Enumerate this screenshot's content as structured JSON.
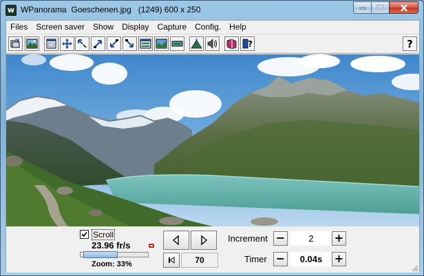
{
  "window": {
    "title": "WPanorama  Goeschenen.jpg   (1249) 600 x 250",
    "icon_letter": "w"
  },
  "caption_buttons": [
    {
      "name": "minimize",
      "icon": "minimize-icon"
    },
    {
      "name": "maximize",
      "icon": "maximize-icon"
    },
    {
      "name": "close",
      "icon": "close-icon"
    }
  ],
  "menu": [
    "Files",
    "Screen saver",
    "Show",
    "Display",
    "Capture",
    "Config.",
    "Help"
  ],
  "toolbar": {
    "buttons": [
      {
        "name": "open-file",
        "icon": "open-file-icon"
      },
      {
        "name": "show-picture",
        "icon": "landscape-picture-icon"
      },
      {
        "name": "window-size",
        "icon": "window-frame-icon"
      },
      {
        "name": "full-screen",
        "icon": "expand-arrows-icon"
      },
      {
        "name": "shrink",
        "icon": "arrow-shrink-icon"
      },
      {
        "name": "expand-up-right",
        "icon": "arrow-up-right-icon"
      },
      {
        "name": "shrink-down-left",
        "icon": "arrow-down-left-icon"
      },
      {
        "name": "expand-down-right",
        "icon": "arrow-down-right-icon"
      },
      {
        "name": "caption-bar",
        "icon": "caption-bar-icon"
      },
      {
        "name": "panorama-view",
        "icon": "panorama-icon"
      },
      {
        "name": "horizontal-scroll",
        "icon": "horizontal-bar-icon"
      },
      {
        "name": "mountain-peak",
        "icon": "mountain-peak-icon"
      },
      {
        "name": "sound",
        "icon": "speaker-icon"
      },
      {
        "name": "book",
        "icon": "book-icon"
      },
      {
        "name": "help-book",
        "icon": "help-book-icon"
      },
      {
        "name": "context-help",
        "icon": "question-mark-icon"
      }
    ]
  },
  "controls": {
    "scroll_checked": true,
    "scroll_label": "Scroll",
    "rate": "23.96 fr/s",
    "zoom_label": "Zoom: 33%",
    "zoom_fraction": 0.33,
    "position_value": "70",
    "increment_label": "Increment",
    "increment_value": "2",
    "timer_label": "Timer",
    "timer_value": "0.04s",
    "minus_symbol": "−",
    "plus_symbol": "+"
  },
  "colors": {
    "accent_blue": "#8db8e3",
    "lake": "#5fb3a8",
    "sky": "#4b8fd0",
    "close_red": "#c2321f"
  }
}
